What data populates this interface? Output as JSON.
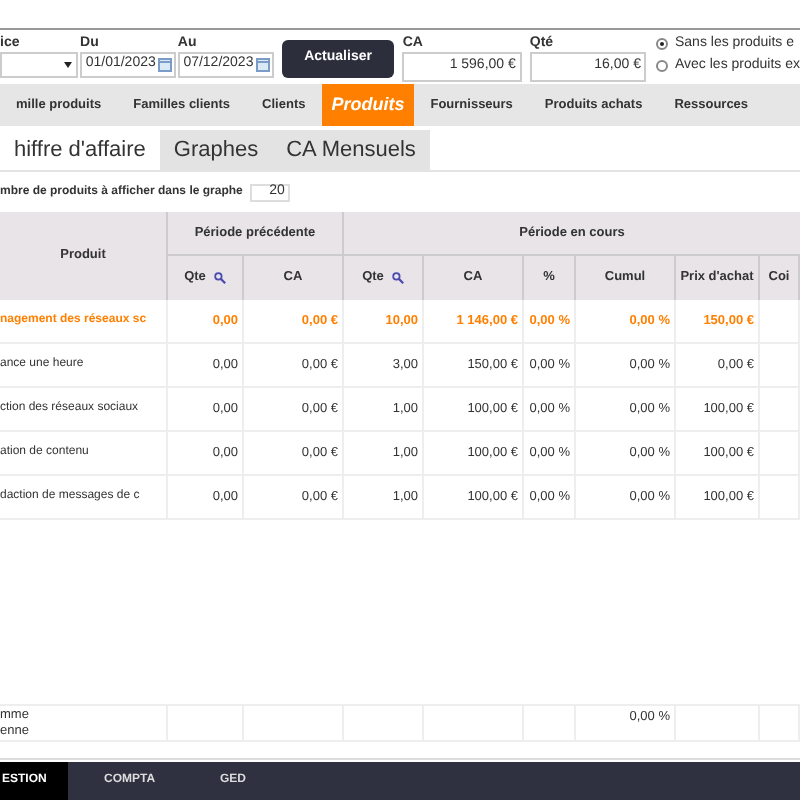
{
  "filters": {
    "entity_label": "ice",
    "du_label": "Du",
    "du_value": "01/01/2023",
    "au_label": "Au",
    "au_value": "07/12/2023",
    "refresh_button": "Actualiser",
    "ca_label": "CA",
    "ca_value": "1 596,00 €",
    "qte_label": "Qté",
    "qte_value": "16,00 €"
  },
  "radios": [
    {
      "label": "Sans les produits e",
      "selected": true
    },
    {
      "label": "Avec les produits ex",
      "selected": false
    }
  ],
  "tabs": [
    {
      "label": "mille produits",
      "selected": false
    },
    {
      "label": "Familles clients",
      "selected": false
    },
    {
      "label": "Clients",
      "selected": false
    },
    {
      "label": "Produits",
      "selected": true
    },
    {
      "label": "Fournisseurs",
      "selected": false
    },
    {
      "label": "Produits achats",
      "selected": false
    },
    {
      "label": "Ressources",
      "selected": false
    }
  ],
  "subtabs": [
    {
      "label": "hiffre d'affaire",
      "selected": true
    },
    {
      "label": "Graphes",
      "selected": false
    },
    {
      "label": "CA Mensuels",
      "selected": false
    }
  ],
  "graph_count": {
    "label": "mbre de produits à afficher dans le graphe",
    "value": "20"
  },
  "table": {
    "group_prev": "Période précédente",
    "group_cur": "Période en cours",
    "columns": [
      "Produit",
      "Qte",
      "CA",
      "Qte",
      "CA",
      "%",
      "Cumul",
      "Prix d'achat",
      "Coi"
    ],
    "rows": [
      {
        "highlighted": true,
        "cells": [
          "nagement des réseaux sc",
          "0,00",
          "0,00 €",
          "10,00",
          "1 146,00 €",
          "0,00 %",
          "0,00 %",
          "150,00 €",
          ""
        ]
      },
      {
        "highlighted": false,
        "cells": [
          "ance une heure",
          "0,00",
          "0,00 €",
          "3,00",
          "150,00 €",
          "0,00 %",
          "0,00 %",
          "0,00 €",
          ""
        ]
      },
      {
        "highlighted": false,
        "cells": [
          "ction des réseaux sociaux",
          "0,00",
          "0,00 €",
          "1,00",
          "100,00 €",
          "0,00 %",
          "0,00 %",
          "100,00 €",
          ""
        ]
      },
      {
        "highlighted": false,
        "cells": [
          "ation de contenu",
          "0,00",
          "0,00 €",
          "1,00",
          "100,00 €",
          "0,00 %",
          "0,00 %",
          "100,00 €",
          ""
        ]
      },
      {
        "highlighted": false,
        "cells": [
          "daction de messages de c",
          "0,00",
          "0,00 €",
          "1,00",
          "100,00 €",
          "0,00 %",
          "0,00 %",
          "100,00 €",
          ""
        ]
      }
    ],
    "footer": {
      "labels": [
        "mme",
        "enne"
      ],
      "cumul": "0,00 %"
    }
  },
  "bottom_tabs": [
    {
      "label": "ESTION",
      "selected": true
    },
    {
      "label": "COMPTA",
      "selected": false
    },
    {
      "label": "GED",
      "selected": false
    }
  ]
}
